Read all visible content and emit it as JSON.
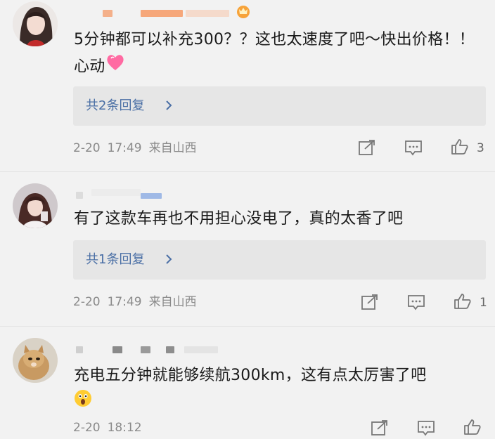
{
  "comments": [
    {
      "text": "5分钟都可以补充300？？这也太速度了吧～快出价格！！心动",
      "emoji_after": "heart-emoji",
      "replies_label": "共2条回复",
      "date": "2-20",
      "time": "17:49",
      "location": "来自山西",
      "like_count": "3"
    },
    {
      "text": "有了这款车再也不用担心没电了，真的太香了吧",
      "replies_label": "共1条回复",
      "date": "2-20",
      "time": "17:49",
      "location": "来自山西",
      "like_count": "1"
    },
    {
      "text": "充电五分钟就能够续航300km，这有点太厉害了吧",
      "emoji_after": "surprised-emoji",
      "date": "2-20",
      "time": "18:12",
      "location": "",
      "like_count": ""
    }
  ],
  "colors": {
    "link": "#4a6fa5",
    "meta": "#8a8a8a",
    "reply_bg": "#e6e6e6",
    "heart": "#ff6aa2"
  }
}
